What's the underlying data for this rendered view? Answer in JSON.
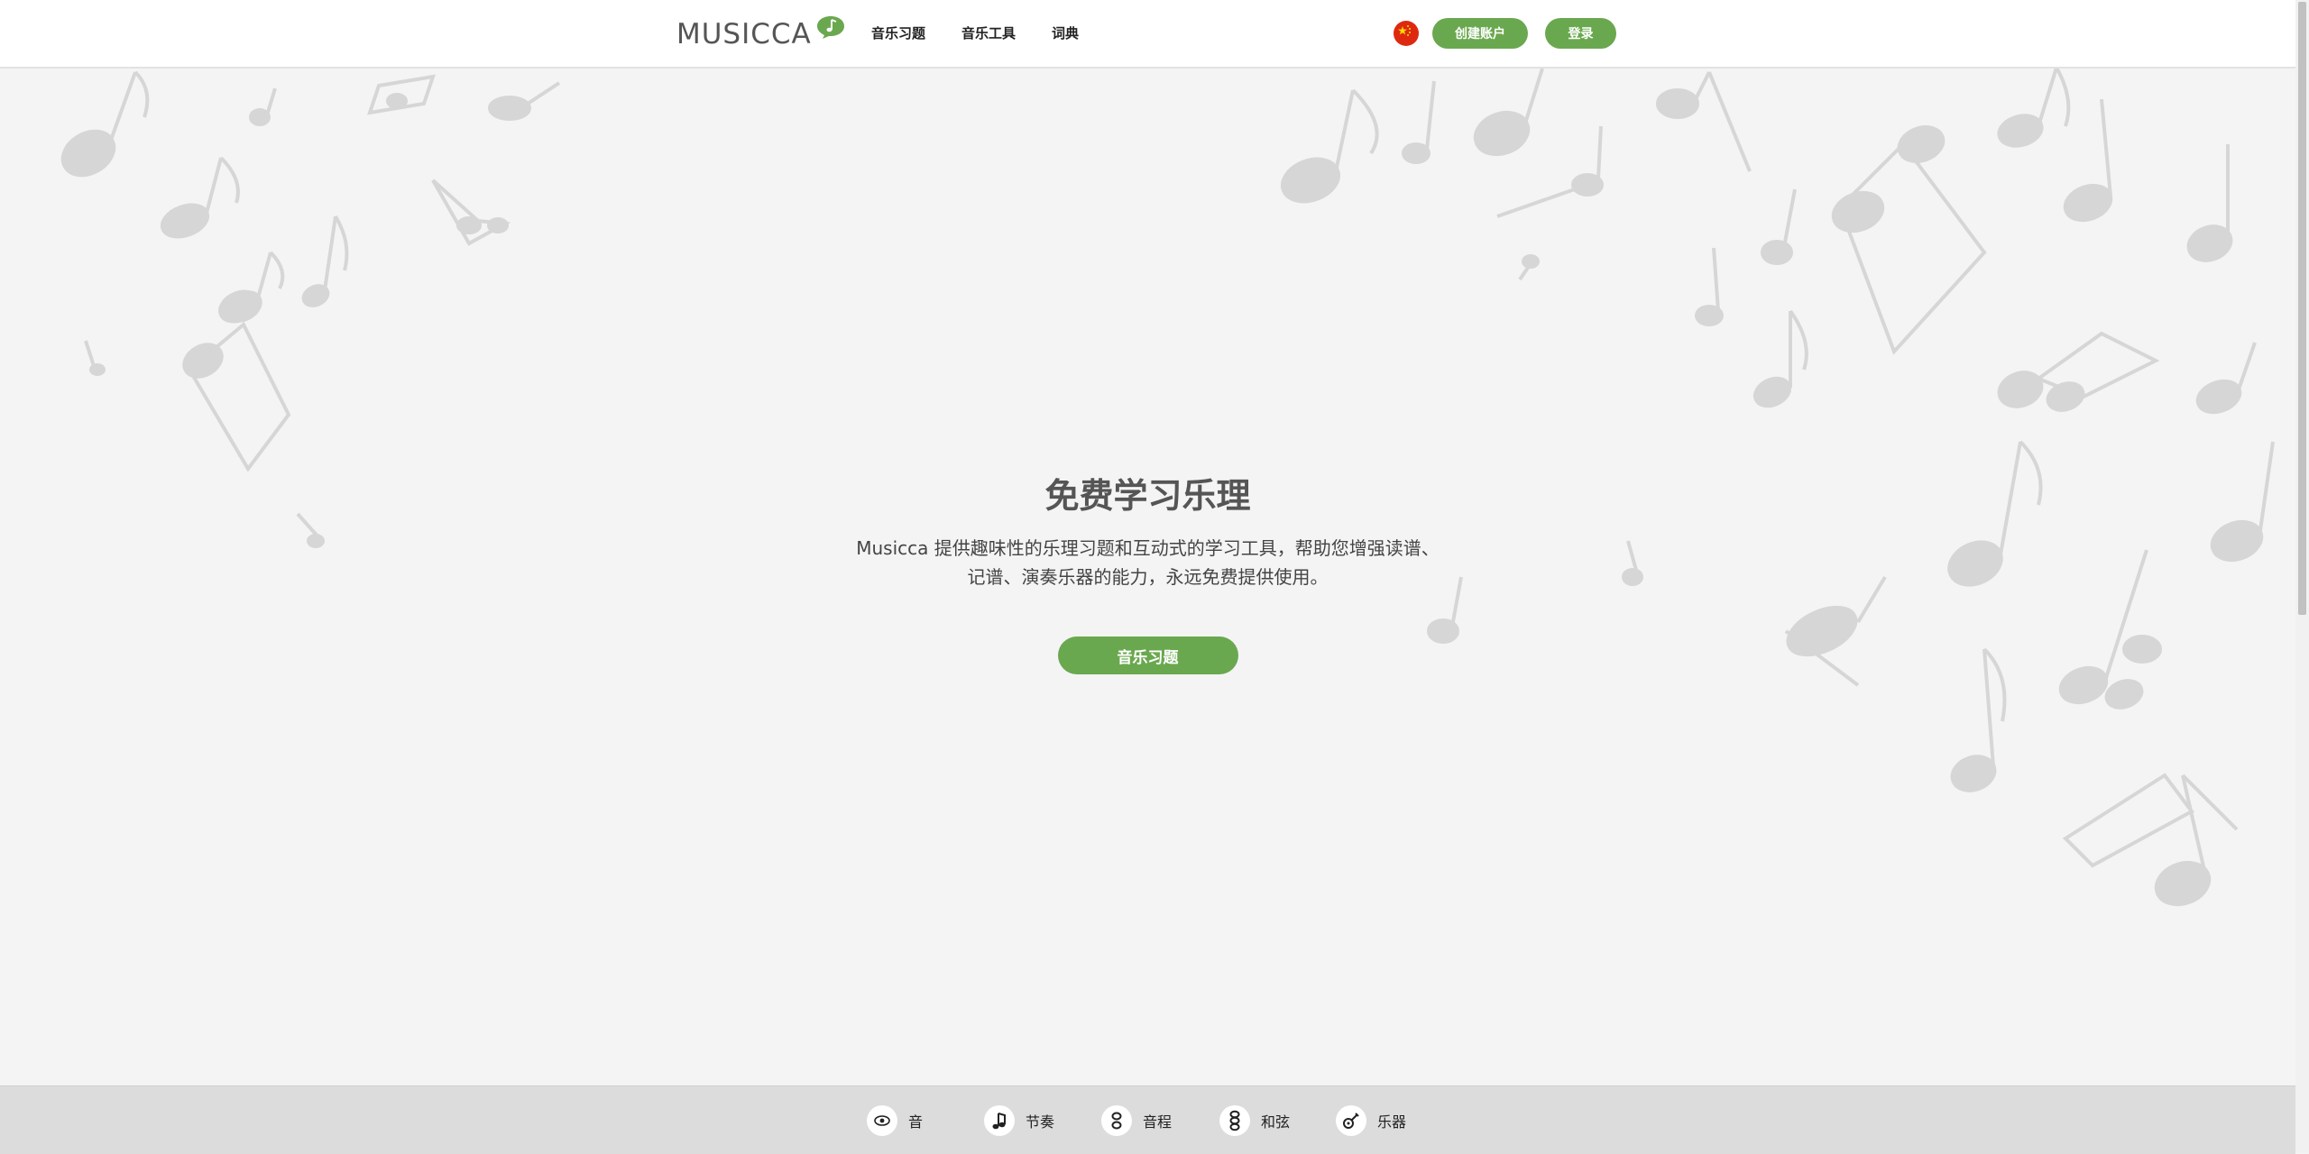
{
  "header": {
    "logo_text": "MUSICCA",
    "nav": [
      {
        "label": "音乐习题"
      },
      {
        "label": "音乐工具"
      },
      {
        "label": "词典"
      }
    ],
    "language_flag": "china-flag-icon",
    "create_account_label": "创建账户",
    "login_label": "登录"
  },
  "hero": {
    "title": "免费学习乐理",
    "description_line1": "Musicca 提供趣味性的乐理习题和互动式的学习工具，帮助您增强读谱、",
    "description_line2": "记谱、演奏乐器的能力，永远免费提供使用。",
    "button_label": "音乐习题"
  },
  "footer": {
    "items": [
      {
        "label": "音",
        "icon": "eye-icon"
      },
      {
        "label": "节奏",
        "icon": "eighth-note-icon"
      },
      {
        "label": "音程",
        "icon": "interval-notes-icon"
      },
      {
        "label": "和弦",
        "icon": "chord-notes-icon"
      },
      {
        "label": "乐器",
        "icon": "guitar-icon"
      }
    ]
  },
  "colors": {
    "accent_green": "#6aa84f",
    "background": "#f4f4f4",
    "footer_bg": "#dcdcdc",
    "note_color": "#d9d9d9"
  }
}
